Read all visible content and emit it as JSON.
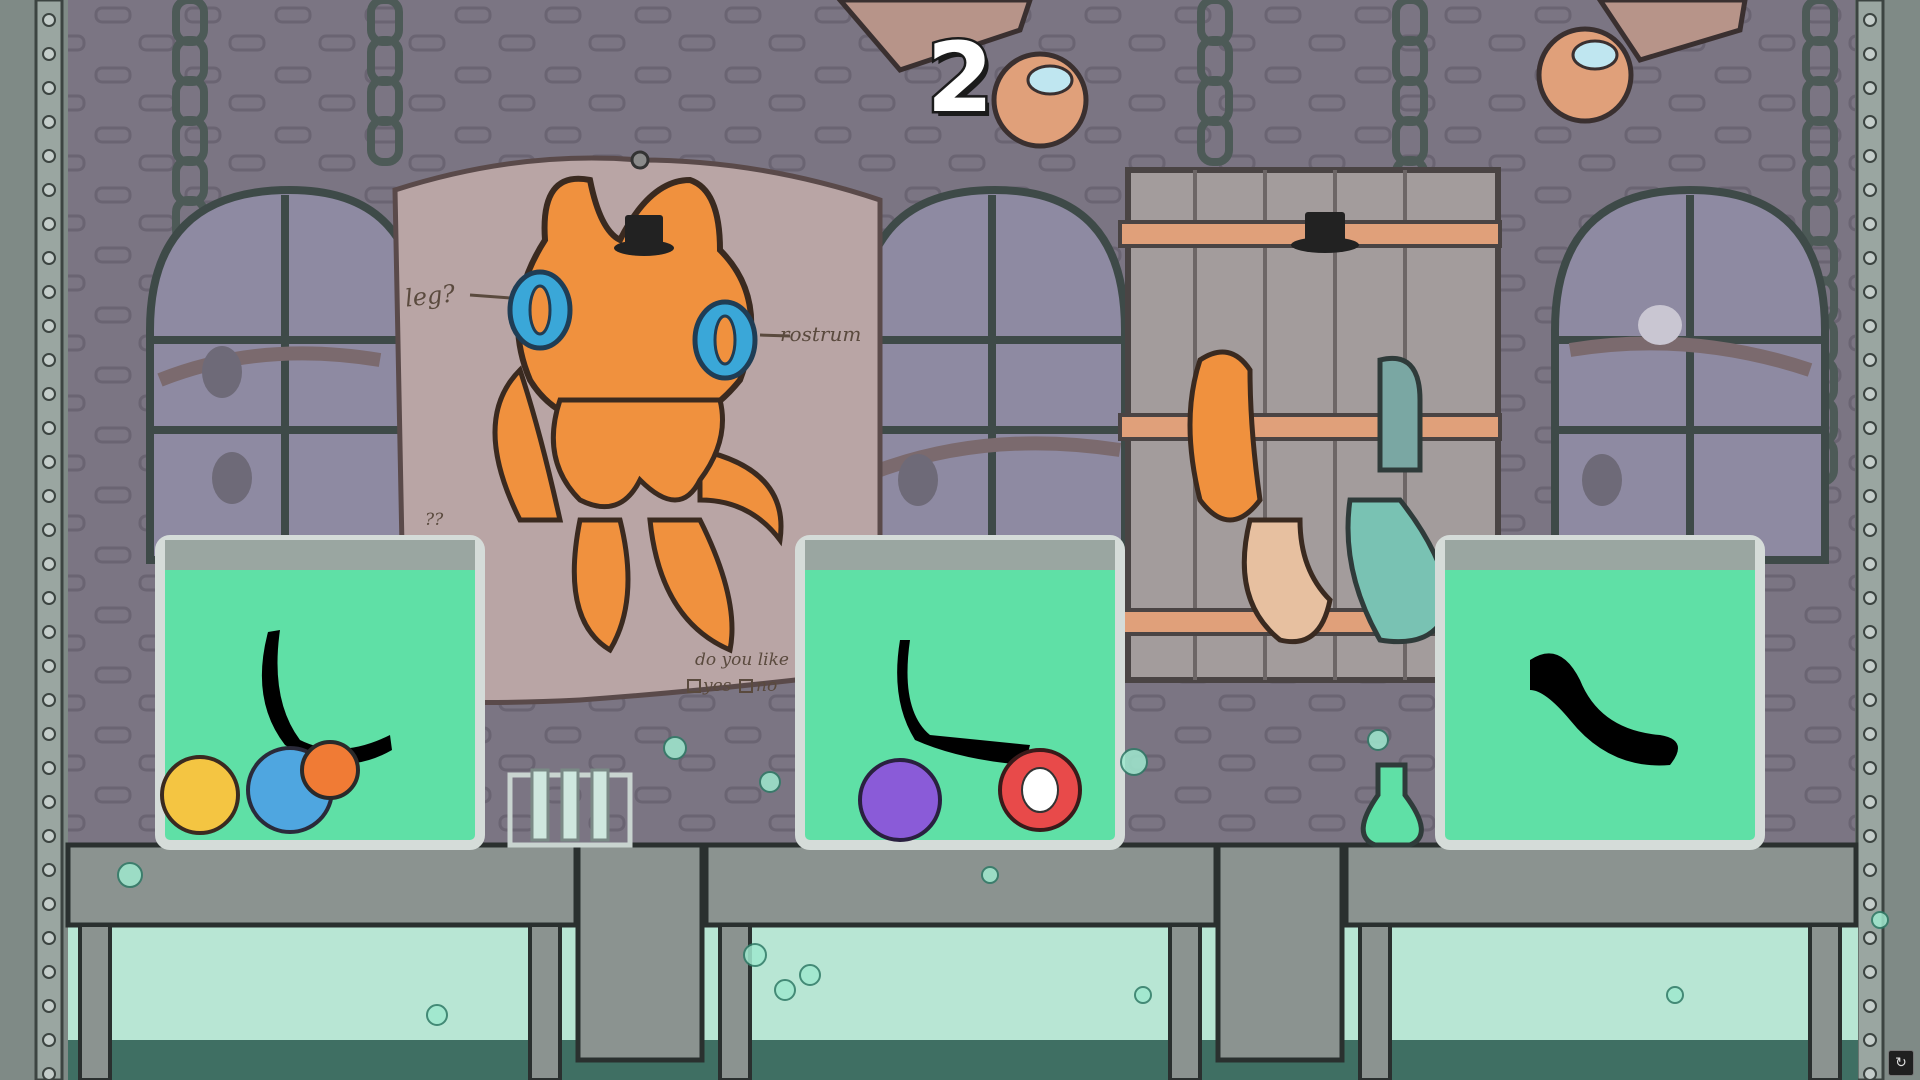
{
  "hud": {
    "countdown": "2"
  },
  "poster": {
    "label_leg": "leg?",
    "label_rostrum": "rostrum",
    "label_unknown": "??",
    "question": "do you like",
    "option_yes": "yes",
    "option_no": "no"
  },
  "stations": [
    {
      "id": "left",
      "silhouette": "right-angle-limb"
    },
    {
      "id": "middle",
      "silhouette": "bent-tentacle"
    },
    {
      "id": "right",
      "silhouette": "curved-worm"
    }
  ],
  "colors": {
    "liquid": "#5fe0a6",
    "octopus": "#f0913e",
    "octopus_sucker": "#3aa7d8",
    "wall": "#7b7583",
    "table": "#8b9390",
    "window_glass": "#8e8aa2"
  },
  "icons": {
    "corner_button": "replay-icon"
  }
}
